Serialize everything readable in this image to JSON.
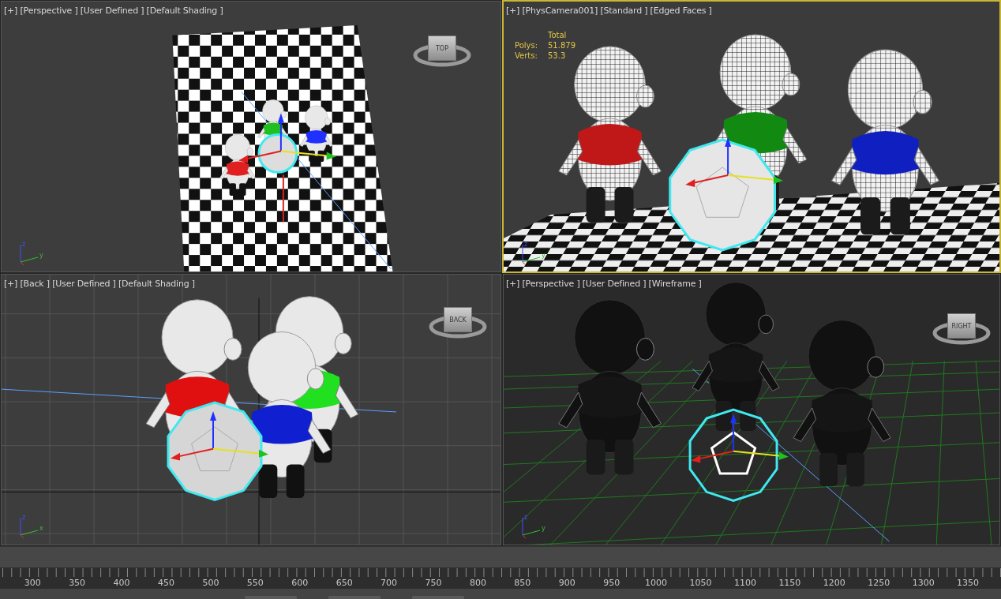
{
  "viewports": [
    {
      "kind": "shaded",
      "label": "[+] [Perspective ] [User Defined ] [Default Shading ]",
      "active": false,
      "cube_face": "TOP",
      "axes": [
        "z",
        "y"
      ]
    },
    {
      "kind": "camera",
      "label": "[+] [PhysCamera001] [Standard ] [Edged Faces ]",
      "active": true,
      "axes": [
        "z",
        "y"
      ],
      "stats": {
        "header": "Total",
        "rows": [
          {
            "label": "Polys:",
            "value": "51.879"
          },
          {
            "label": "Verts:",
            "value": "53.3"
          }
        ]
      }
    },
    {
      "kind": "ortho",
      "label": "[+] [Back ] [User Defined ] [Default Shading ]",
      "active": false,
      "cube_face": "BACK",
      "axes": [
        "z",
        "x"
      ]
    },
    {
      "kind": "wireframe",
      "label": "[+] [Perspective ] [User Defined ] [Wireframe ]",
      "active": false,
      "cube_face": "RIGHT",
      "axes": [
        "z",
        "y"
      ]
    }
  ],
  "timeline": {
    "ticks": [
      "300",
      "350",
      "400",
      "450",
      "500",
      "550",
      "600",
      "650",
      "700",
      "750",
      "800",
      "850",
      "900",
      "950",
      "1000",
      "1050",
      "1100",
      "1150",
      "1200",
      "1250",
      "1300",
      "1350"
    ]
  }
}
